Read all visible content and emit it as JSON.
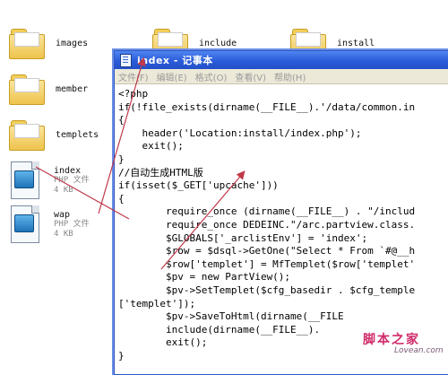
{
  "explorer": {
    "folders": [
      "images",
      "include",
      "install",
      "member",
      "templets"
    ],
    "files": [
      {
        "name": "index",
        "type": "PHP 文件",
        "size": "4 KB"
      },
      {
        "name": "wap",
        "type": "PHP 文件",
        "size": "4 KB"
      }
    ]
  },
  "notepad": {
    "title": "index - 记事本",
    "menu": [
      "文件(F)",
      "编辑(E)",
      "格式(O)",
      "查看(V)",
      "帮助(H)"
    ],
    "code_lines": [
      "<?php",
      "if(!file_exists(dirname(__FILE__).'/data/common.in",
      "{",
      "    header('Location:install/index.php');",
      "    exit();",
      "}",
      "//自动生成HTML版",
      "if(isset($_GET['upcache']))",
      "{",
      "        require_once (dirname(__FILE__) . \"/includ",
      "        require_once DEDEINC.\"/arc.partview.class.",
      "        $GLOBALS['_arclistEnv'] = 'index';",
      "        $row = $dsql->GetOne(\"Select * From `#@__h",
      "        $row['templet'] = MfTemplet($row['templet'",
      "        $pv = new PartView();",
      "        $pv->SetTemplet($cfg_basedir . $cfg_temple",
      "['templet']);",
      "        $pv->SaveToHtml(dirname(__FILE",
      "        include(dirname(__FILE__).",
      "        exit();",
      "}"
    ]
  },
  "watermark": {
    "main": "脚本之家",
    "sub": "Lovean.com"
  },
  "colors": {
    "titlebar": "#2a5bd9",
    "annotation_arrow": "#c0394a",
    "watermark": "#d02b6a"
  }
}
